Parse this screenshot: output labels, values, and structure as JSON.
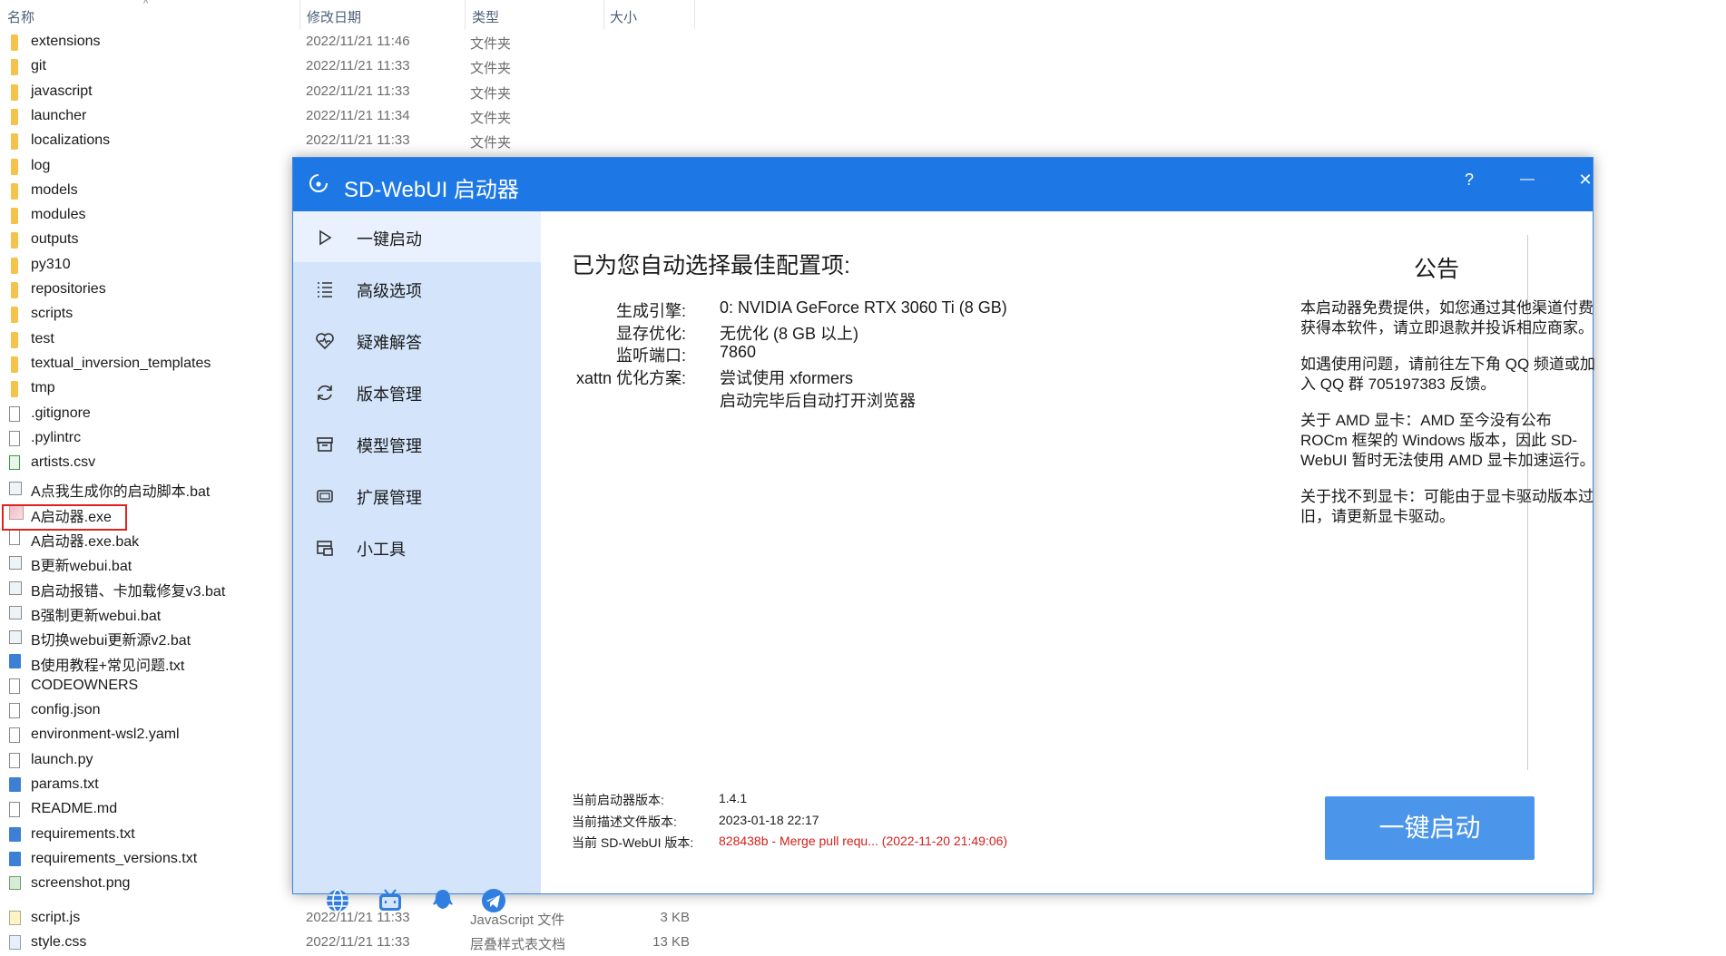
{
  "explorer": {
    "columns": {
      "name": "名称",
      "date": "修改日期",
      "type": "类型",
      "size": "大小"
    },
    "rows": [
      {
        "name": "extensions",
        "date": "2022/11/21 11:46",
        "type": "文件夹",
        "icon": "folder-icon"
      },
      {
        "name": "git",
        "date": "2022/11/21 11:33",
        "type": "文件夹",
        "icon": "folder-icon"
      },
      {
        "name": "javascript",
        "date": "2022/11/21 11:33",
        "type": "文件夹",
        "icon": "folder-icon"
      },
      {
        "name": "launcher",
        "date": "2022/11/21 11:34",
        "type": "文件夹",
        "icon": "folder-icon"
      },
      {
        "name": "localizations",
        "date": "2022/11/21 11:33",
        "type": "文件夹",
        "icon": "folder-icon"
      },
      {
        "name": "log",
        "icon": "folder-icon"
      },
      {
        "name": "models",
        "icon": "folder-icon"
      },
      {
        "name": "modules",
        "icon": "folder-icon"
      },
      {
        "name": "outputs",
        "icon": "folder-icon"
      },
      {
        "name": "py310",
        "icon": "folder-icon"
      },
      {
        "name": "repositories",
        "icon": "folder-icon"
      },
      {
        "name": "scripts",
        "icon": "folder-icon"
      },
      {
        "name": "test",
        "icon": "folder-icon"
      },
      {
        "name": "textual_inversion_templates",
        "icon": "folder-icon"
      },
      {
        "name": "tmp",
        "icon": "folder-icon"
      },
      {
        "name": ".gitignore",
        "icon": "file-icon"
      },
      {
        "name": ".pylintrc",
        "icon": "file-icon"
      },
      {
        "name": "artists.csv",
        "icon": "csv-file-icon"
      },
      {
        "name": "A点我生成你的启动脚本.bat",
        "icon": "bat-file-icon"
      },
      {
        "name": "A启动器.exe",
        "icon": "exe-file-icon"
      },
      {
        "name": "A启动器.exe.bak",
        "icon": "file-icon"
      },
      {
        "name": "B更新webui.bat",
        "icon": "bat-file-icon"
      },
      {
        "name": "B启动报错、卡加载修复v3.bat",
        "icon": "bat-file-icon"
      },
      {
        "name": "B强制更新webui.bat",
        "icon": "bat-file-icon"
      },
      {
        "name": "B切换webui更新源v2.bat",
        "icon": "bat-file-icon"
      },
      {
        "name": "B使用教程+常见问题.txt",
        "icon": "txt-file-icon"
      },
      {
        "name": "CODEOWNERS",
        "icon": "file-icon"
      },
      {
        "name": "config.json",
        "icon": "file-icon"
      },
      {
        "name": "environment-wsl2.yaml",
        "icon": "file-icon"
      },
      {
        "name": "launch.py",
        "icon": "file-icon"
      },
      {
        "name": "params.txt",
        "icon": "txt-file-icon"
      },
      {
        "name": "README.md",
        "icon": "file-icon"
      },
      {
        "name": "requirements.txt",
        "icon": "txt-file-icon"
      },
      {
        "name": "requirements_versions.txt",
        "icon": "txt-file-icon"
      },
      {
        "name": "screenshot.png",
        "icon": "png-file-icon"
      },
      {
        "name": "script.js",
        "date": "2022/11/21 11:33",
        "type": "JavaScript 文件",
        "size": "3 KB",
        "icon": "js-file-icon"
      },
      {
        "name": "style.css",
        "date": "2022/11/21 11:33",
        "type": "层叠样式表文档",
        "size": "13 KB",
        "icon": "css-file-icon"
      }
    ]
  },
  "launcher": {
    "title": "SD-WebUI 启动器",
    "window_buttons": {
      "help": "?",
      "minimize": "—",
      "close": "✕"
    },
    "nav": [
      {
        "label": "一键启动",
        "icon": "play-icon"
      },
      {
        "label": "高级选项",
        "icon": "list-icon"
      },
      {
        "label": "疑难解答",
        "icon": "heart-pulse-icon"
      },
      {
        "label": "版本管理",
        "icon": "refresh-icon"
      },
      {
        "label": "模型管理",
        "icon": "archive-icon"
      },
      {
        "label": "扩展管理",
        "icon": "chip-icon"
      },
      {
        "label": "小工具",
        "icon": "toolbox-icon"
      }
    ],
    "social_icons": [
      "globe-icon",
      "bilibili-icon",
      "qq-icon",
      "telegram-icon"
    ],
    "config": {
      "heading": "已为您自动选择最佳配置项:",
      "rows": [
        {
          "label": "生成引擎:",
          "value": "0: NVIDIA GeForce RTX 3060 Ti (8 GB)"
        },
        {
          "label": "显存优化:",
          "value": "无优化 (8 GB 以上)"
        },
        {
          "label": "监听端口:",
          "value": "7860"
        },
        {
          "label": "xattn 优化方案:",
          "value": "尝试使用 xformers"
        },
        {
          "label": "",
          "value": "启动完毕后自动打开浏览器"
        }
      ]
    },
    "notice": {
      "heading": "公告",
      "paragraphs": [
        "本启动器免费提供，如您通过其他渠道付费获得本软件，请立即退款并投诉相应商家。",
        "如遇使用问题，请前往左下角 QQ 频道或加入 QQ 群 705197383 反馈。",
        "关于 AMD 显卡：AMD 至今没有公布 ROCm 框架的 Windows 版本，因此 SD-WebUI 暂时无法使用 AMD 显卡加速运行。",
        "关于找不到显卡：可能由于显卡驱动版本过旧，请更新显卡驱动。"
      ]
    },
    "versions": [
      {
        "label": "当前启动器版本:",
        "value": "1.4.1"
      },
      {
        "label": "当前描述文件版本:",
        "value": "2023-01-18 22:17"
      },
      {
        "label": "当前 SD-WebUI 版本:",
        "value": "828438b - Merge pull requ... (2022-11-20 21:49:06)"
      }
    ],
    "version_warning_color": "#d0201b",
    "launch_button": "一键启动",
    "accent": "#1d78e6",
    "button_color": "#4b95ea",
    "sidebar_color": "#d3e4fb"
  }
}
